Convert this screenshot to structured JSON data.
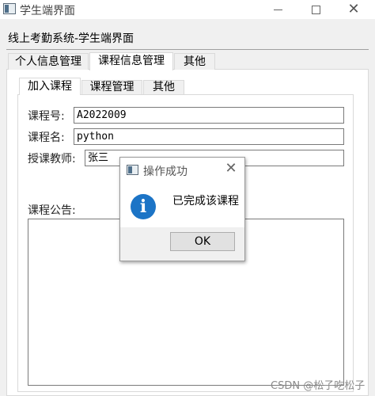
{
  "window": {
    "title": "学生端界面"
  },
  "heading": "线上考勤系统-学生端界面",
  "outer_tabs": [
    {
      "label": "个人信息管理"
    },
    {
      "label": "课程信息管理"
    },
    {
      "label": "其他"
    }
  ],
  "inner_tabs": [
    {
      "label": "加入课程"
    },
    {
      "label": "课程管理"
    },
    {
      "label": "其他"
    }
  ],
  "form": {
    "code_label": "课程号:",
    "code_value": "A2022009",
    "name_label": "课程名:",
    "name_value": "python",
    "teacher_label": "授课教师:",
    "teacher_value": "张三",
    "notice_label": "课程公告:",
    "notice_value": ""
  },
  "dialog": {
    "title": "操作成功",
    "message": "已完成该课程",
    "ok_label": "OK",
    "icon": "info-icon"
  },
  "watermark": "CSDN @松子吃松子",
  "colors": {
    "info_blue": "#1c74c6",
    "window_bg": "#f0f0f0"
  }
}
